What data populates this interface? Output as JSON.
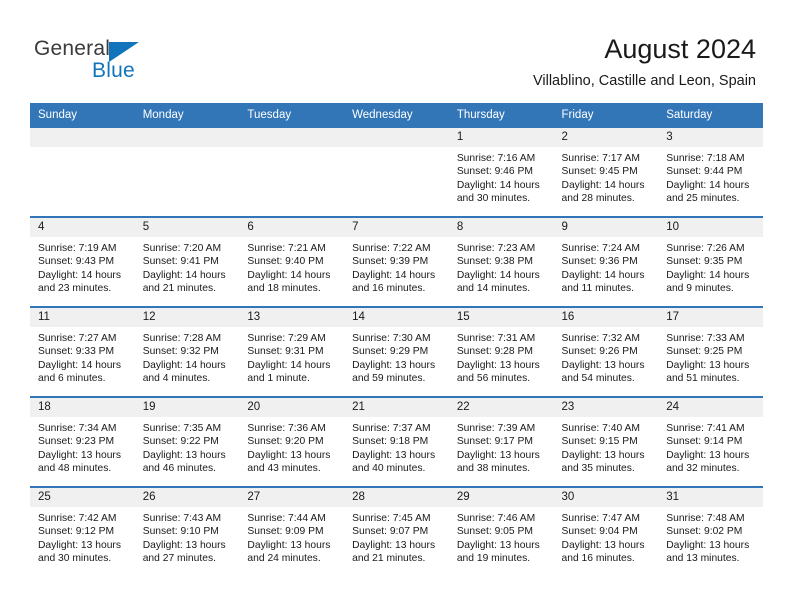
{
  "brand": {
    "name_part1": "General",
    "name_part2": "Blue",
    "accent_color": "#1275bc",
    "triangle_icon": "triangle-icon"
  },
  "header": {
    "title": "August 2024",
    "location": "Villablino, Castille and Leon, Spain"
  },
  "theme": {
    "header_blue": "#3276b8",
    "daynum_gray": "#f0f0f0",
    "text": "#1a1a1a"
  },
  "weekdays": [
    "Sunday",
    "Monday",
    "Tuesday",
    "Wednesday",
    "Thursday",
    "Friday",
    "Saturday"
  ],
  "weeks": [
    [
      {
        "day": "",
        "blank": true
      },
      {
        "day": "",
        "blank": true
      },
      {
        "day": "",
        "blank": true
      },
      {
        "day": "",
        "blank": true
      },
      {
        "day": "1",
        "sunrise": "Sunrise: 7:16 AM",
        "sunset": "Sunset: 9:46 PM",
        "daylight_1": "Daylight: 14 hours",
        "daylight_2": "and 30 minutes."
      },
      {
        "day": "2",
        "sunrise": "Sunrise: 7:17 AM",
        "sunset": "Sunset: 9:45 PM",
        "daylight_1": "Daylight: 14 hours",
        "daylight_2": "and 28 minutes."
      },
      {
        "day": "3",
        "sunrise": "Sunrise: 7:18 AM",
        "sunset": "Sunset: 9:44 PM",
        "daylight_1": "Daylight: 14 hours",
        "daylight_2": "and 25 minutes."
      }
    ],
    [
      {
        "day": "4",
        "sunrise": "Sunrise: 7:19 AM",
        "sunset": "Sunset: 9:43 PM",
        "daylight_1": "Daylight: 14 hours",
        "daylight_2": "and 23 minutes."
      },
      {
        "day": "5",
        "sunrise": "Sunrise: 7:20 AM",
        "sunset": "Sunset: 9:41 PM",
        "daylight_1": "Daylight: 14 hours",
        "daylight_2": "and 21 minutes."
      },
      {
        "day": "6",
        "sunrise": "Sunrise: 7:21 AM",
        "sunset": "Sunset: 9:40 PM",
        "daylight_1": "Daylight: 14 hours",
        "daylight_2": "and 18 minutes."
      },
      {
        "day": "7",
        "sunrise": "Sunrise: 7:22 AM",
        "sunset": "Sunset: 9:39 PM",
        "daylight_1": "Daylight: 14 hours",
        "daylight_2": "and 16 minutes."
      },
      {
        "day": "8",
        "sunrise": "Sunrise: 7:23 AM",
        "sunset": "Sunset: 9:38 PM",
        "daylight_1": "Daylight: 14 hours",
        "daylight_2": "and 14 minutes."
      },
      {
        "day": "9",
        "sunrise": "Sunrise: 7:24 AM",
        "sunset": "Sunset: 9:36 PM",
        "daylight_1": "Daylight: 14 hours",
        "daylight_2": "and 11 minutes."
      },
      {
        "day": "10",
        "sunrise": "Sunrise: 7:26 AM",
        "sunset": "Sunset: 9:35 PM",
        "daylight_1": "Daylight: 14 hours",
        "daylight_2": "and 9 minutes."
      }
    ],
    [
      {
        "day": "11",
        "sunrise": "Sunrise: 7:27 AM",
        "sunset": "Sunset: 9:33 PM",
        "daylight_1": "Daylight: 14 hours",
        "daylight_2": "and 6 minutes."
      },
      {
        "day": "12",
        "sunrise": "Sunrise: 7:28 AM",
        "sunset": "Sunset: 9:32 PM",
        "daylight_1": "Daylight: 14 hours",
        "daylight_2": "and 4 minutes."
      },
      {
        "day": "13",
        "sunrise": "Sunrise: 7:29 AM",
        "sunset": "Sunset: 9:31 PM",
        "daylight_1": "Daylight: 14 hours",
        "daylight_2": "and 1 minute."
      },
      {
        "day": "14",
        "sunrise": "Sunrise: 7:30 AM",
        "sunset": "Sunset: 9:29 PM",
        "daylight_1": "Daylight: 13 hours",
        "daylight_2": "and 59 minutes."
      },
      {
        "day": "15",
        "sunrise": "Sunrise: 7:31 AM",
        "sunset": "Sunset: 9:28 PM",
        "daylight_1": "Daylight: 13 hours",
        "daylight_2": "and 56 minutes."
      },
      {
        "day": "16",
        "sunrise": "Sunrise: 7:32 AM",
        "sunset": "Sunset: 9:26 PM",
        "daylight_1": "Daylight: 13 hours",
        "daylight_2": "and 54 minutes."
      },
      {
        "day": "17",
        "sunrise": "Sunrise: 7:33 AM",
        "sunset": "Sunset: 9:25 PM",
        "daylight_1": "Daylight: 13 hours",
        "daylight_2": "and 51 minutes."
      }
    ],
    [
      {
        "day": "18",
        "sunrise": "Sunrise: 7:34 AM",
        "sunset": "Sunset: 9:23 PM",
        "daylight_1": "Daylight: 13 hours",
        "daylight_2": "and 48 minutes."
      },
      {
        "day": "19",
        "sunrise": "Sunrise: 7:35 AM",
        "sunset": "Sunset: 9:22 PM",
        "daylight_1": "Daylight: 13 hours",
        "daylight_2": "and 46 minutes."
      },
      {
        "day": "20",
        "sunrise": "Sunrise: 7:36 AM",
        "sunset": "Sunset: 9:20 PM",
        "daylight_1": "Daylight: 13 hours",
        "daylight_2": "and 43 minutes."
      },
      {
        "day": "21",
        "sunrise": "Sunrise: 7:37 AM",
        "sunset": "Sunset: 9:18 PM",
        "daylight_1": "Daylight: 13 hours",
        "daylight_2": "and 40 minutes."
      },
      {
        "day": "22",
        "sunrise": "Sunrise: 7:39 AM",
        "sunset": "Sunset: 9:17 PM",
        "daylight_1": "Daylight: 13 hours",
        "daylight_2": "and 38 minutes."
      },
      {
        "day": "23",
        "sunrise": "Sunrise: 7:40 AM",
        "sunset": "Sunset: 9:15 PM",
        "daylight_1": "Daylight: 13 hours",
        "daylight_2": "and 35 minutes."
      },
      {
        "day": "24",
        "sunrise": "Sunrise: 7:41 AM",
        "sunset": "Sunset: 9:14 PM",
        "daylight_1": "Daylight: 13 hours",
        "daylight_2": "and 32 minutes."
      }
    ],
    [
      {
        "day": "25",
        "sunrise": "Sunrise: 7:42 AM",
        "sunset": "Sunset: 9:12 PM",
        "daylight_1": "Daylight: 13 hours",
        "daylight_2": "and 30 minutes."
      },
      {
        "day": "26",
        "sunrise": "Sunrise: 7:43 AM",
        "sunset": "Sunset: 9:10 PM",
        "daylight_1": "Daylight: 13 hours",
        "daylight_2": "and 27 minutes."
      },
      {
        "day": "27",
        "sunrise": "Sunrise: 7:44 AM",
        "sunset": "Sunset: 9:09 PM",
        "daylight_1": "Daylight: 13 hours",
        "daylight_2": "and 24 minutes."
      },
      {
        "day": "28",
        "sunrise": "Sunrise: 7:45 AM",
        "sunset": "Sunset: 9:07 PM",
        "daylight_1": "Daylight: 13 hours",
        "daylight_2": "and 21 minutes."
      },
      {
        "day": "29",
        "sunrise": "Sunrise: 7:46 AM",
        "sunset": "Sunset: 9:05 PM",
        "daylight_1": "Daylight: 13 hours",
        "daylight_2": "and 19 minutes."
      },
      {
        "day": "30",
        "sunrise": "Sunrise: 7:47 AM",
        "sunset": "Sunset: 9:04 PM",
        "daylight_1": "Daylight: 13 hours",
        "daylight_2": "and 16 minutes."
      },
      {
        "day": "31",
        "sunrise": "Sunrise: 7:48 AM",
        "sunset": "Sunset: 9:02 PM",
        "daylight_1": "Daylight: 13 hours",
        "daylight_2": "and 13 minutes."
      }
    ]
  ]
}
